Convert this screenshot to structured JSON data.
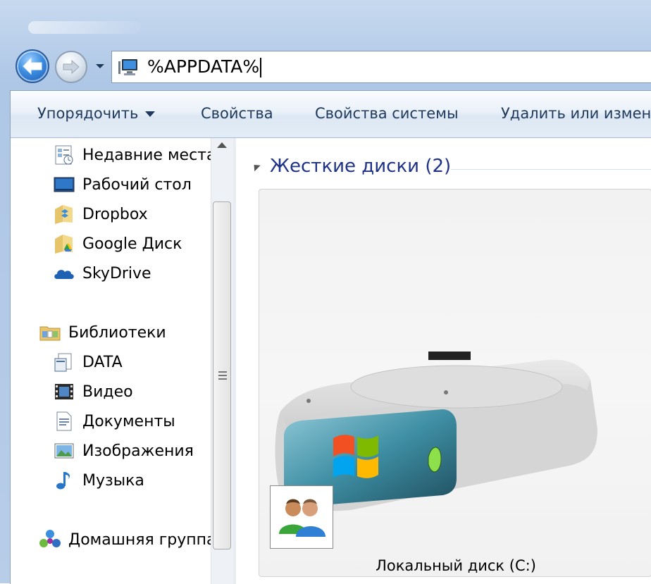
{
  "address": {
    "value": "%APPDATA%"
  },
  "toolbar": {
    "organize": "Упорядочить",
    "properties": "Свойства",
    "system_properties": "Свойства системы",
    "uninstall": "Удалить или измени"
  },
  "navigation": {
    "favorites": [
      {
        "label": "Недавние места",
        "icon": "recent-places-icon"
      },
      {
        "label": "Рабочий стол",
        "icon": "desktop-icon"
      },
      {
        "label": "Dropbox",
        "icon": "dropbox-icon"
      },
      {
        "label": "Google Диск",
        "icon": "google-drive-icon"
      },
      {
        "label": "SkyDrive",
        "icon": "skydrive-icon"
      }
    ],
    "libraries": {
      "label": "Библиотеки",
      "items": [
        {
          "label": "DATA",
          "icon": "library-icon"
        },
        {
          "label": "Видео",
          "icon": "video-icon"
        },
        {
          "label": "Документы",
          "icon": "documents-icon"
        },
        {
          "label": "Изображения",
          "icon": "pictures-icon"
        },
        {
          "label": "Музыка",
          "icon": "music-icon"
        }
      ]
    },
    "homegroup": {
      "label": "Домашняя группа",
      "icon": "homegroup-icon"
    }
  },
  "content": {
    "group_header": "Жесткие диски (2)",
    "drives": [
      {
        "label": "Локальный диск (C:)",
        "icon": "hard-drive-icon",
        "overlay": "shared-users-icon"
      }
    ]
  },
  "colors": {
    "accent": "#1e3287",
    "toolbar_text": "#1e395b",
    "frame": "#b9cfea"
  }
}
